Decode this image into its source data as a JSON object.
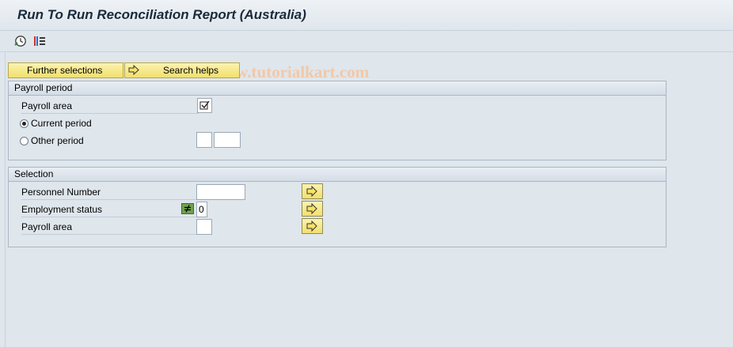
{
  "window": {
    "title": "Run To Run Reconciliation Report (Australia)"
  },
  "toolbar": {
    "items": [
      {
        "icon": "execute-clock-icon"
      },
      {
        "icon": "selection-options-icon"
      }
    ]
  },
  "watermark": "© www.tutorialkart.com",
  "buttons": {
    "further_selections": "Further selections",
    "search_helps": "Search helps"
  },
  "payroll_period": {
    "header": "Payroll period",
    "payroll_area_label": "Payroll area",
    "payroll_area_checked": true,
    "current_period_label": "Current period",
    "current_period_selected": true,
    "other_period_label": "Other period",
    "other_period_selected": false,
    "other_period_from": "",
    "other_period_to": ""
  },
  "selection": {
    "header": "Selection",
    "rows": [
      {
        "label": "Personnel Number",
        "value": ""
      },
      {
        "label": "Employment status",
        "value": "0",
        "operator": "not-equal"
      },
      {
        "label": "Payroll area",
        "value": ""
      }
    ]
  },
  "colors": {
    "background": "#dfe6ec",
    "button_yellow": "#f2df6c",
    "operator_green": "#6fa24c",
    "watermark": "#f2c8a8"
  }
}
